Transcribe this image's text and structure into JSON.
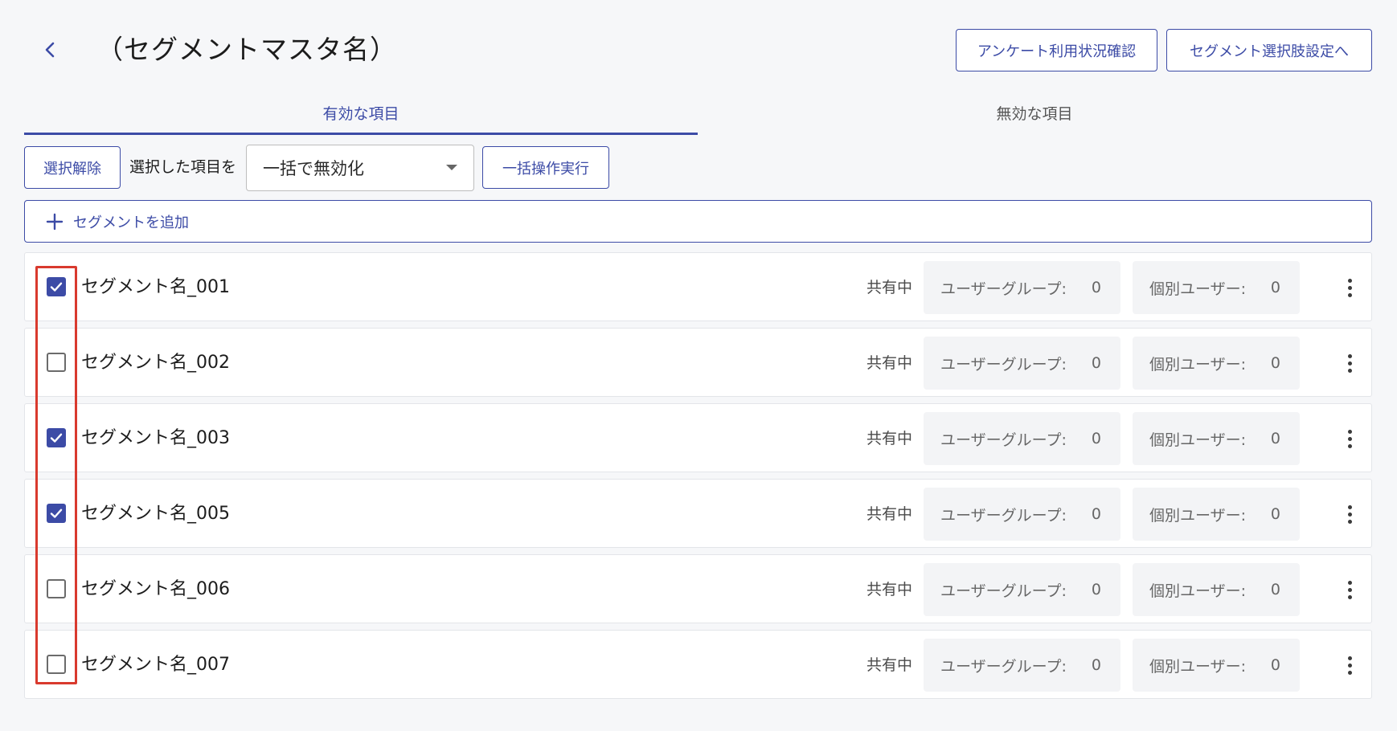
{
  "header": {
    "title": "（セグメントマスタ名）",
    "survey_button": "アンケート利用状況確認",
    "segment_select_button": "セグメント選択肢設定へ"
  },
  "tabs": [
    {
      "label": "有効な項目",
      "active": true
    },
    {
      "label": "無効な項目",
      "active": false
    }
  ],
  "toolbar": {
    "deselect_button": "選択解除",
    "selected_items_label": "選択した項目を",
    "bulk_action_value": "一括で無効化",
    "execute_button": "一括操作実行"
  },
  "add_segment": {
    "icon": "plus-icon",
    "label": "セグメントを追加"
  },
  "segments": [
    {
      "name": "セグメント名_001",
      "checked": true,
      "status": "共有中",
      "user_group_label": "ユーザーグループ:",
      "user_group_count": "0",
      "individual_user_label": "個別ユーザー:",
      "individual_user_count": "0"
    },
    {
      "name": "セグメント名_002",
      "checked": false,
      "status": "共有中",
      "user_group_label": "ユーザーグループ:",
      "user_group_count": "0",
      "individual_user_label": "個別ユーザー:",
      "individual_user_count": "0"
    },
    {
      "name": "セグメント名_003",
      "checked": true,
      "status": "共有中",
      "user_group_label": "ユーザーグループ:",
      "user_group_count": "0",
      "individual_user_label": "個別ユーザー:",
      "individual_user_count": "0"
    },
    {
      "name": "セグメント名_005",
      "checked": true,
      "status": "共有中",
      "user_group_label": "ユーザーグループ:",
      "user_group_count": "0",
      "individual_user_label": "個別ユーザー:",
      "individual_user_count": "0"
    },
    {
      "name": "セグメント名_006",
      "checked": false,
      "status": "共有中",
      "user_group_label": "ユーザーグループ:",
      "user_group_count": "0",
      "individual_user_label": "個別ユーザー:",
      "individual_user_count": "0"
    },
    {
      "name": "セグメント名_007",
      "checked": false,
      "status": "共有中",
      "user_group_label": "ユーザーグループ:",
      "user_group_count": "0",
      "individual_user_label": "個別ユーザー:",
      "individual_user_count": "0"
    }
  ],
  "colors": {
    "accent": "#3c4ba6",
    "highlight": "#d93a2e",
    "background": "#f6f7f9"
  }
}
